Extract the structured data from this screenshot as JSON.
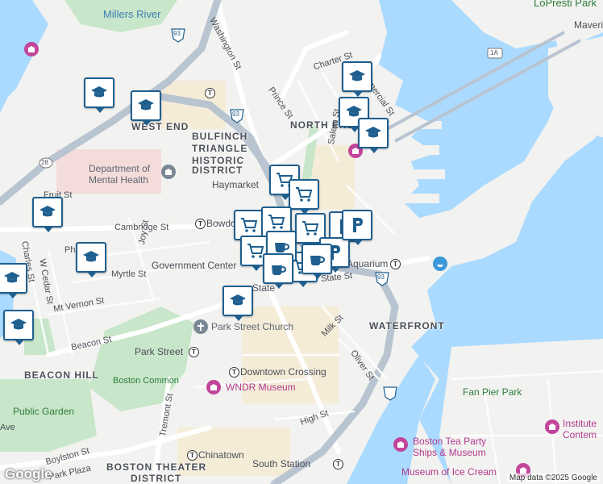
{
  "map": {
    "neighborhoods": [
      "NORTH END",
      "WEST END",
      "BULFINCH",
      "TRIANGLE",
      "HISTORIC",
      "DISTRICT",
      "WATERFRONT",
      "BEACON HILL",
      "BOSTON THEATER",
      "DISTRICT"
    ],
    "water_labels": [
      "Millers River",
      "LoPresti Park"
    ],
    "streets": [
      "Washington St",
      "Charter St",
      "Commercial St",
      "Prince St",
      "Salem St",
      "Cambridge St",
      "Joy St",
      "Charles St",
      "W Cedar St",
      "Myrtle St",
      "Mt Vernon St",
      "Beacon St",
      "Milk St",
      "State St",
      "Oliver St",
      "High St",
      "Tremont St",
      "Boylston St",
      "Park Plaza",
      "Fruit St",
      "Phillips St",
      "Maverick",
      "Ave"
    ],
    "stations": [
      "Haymarket",
      "Bowdoin",
      "Government Center",
      "State",
      "Aquarium",
      "Park Street",
      "Downtown Crossing",
      "Chinatown",
      "South Station"
    ],
    "pois": [
      "Department of",
      "Mental Health",
      "Park Street Church",
      "WNDR Museum",
      "Boston Common",
      "Public Garden",
      "Fan Pier Park",
      "Boston Tea Party",
      "Ships & Museum",
      "Museum of Ice Cream",
      "Institute",
      "Contem"
    ],
    "route_shields": [
      "93",
      "93",
      "93",
      "28",
      "1A"
    ],
    "attribution": "Map data ©2025 Google",
    "logo": "Google",
    "colors": {
      "water": "#aadaff",
      "land": "#f2f2f0",
      "park": "#c8e6c9",
      "road_major": "#ffffff",
      "highway": "#b9c4d1",
      "pin_border": "#1f5f8f",
      "poi_museum": "#c2459b"
    }
  },
  "markers": {
    "icons": [
      "school-icon",
      "shopping-cart-icon",
      "coffee-icon",
      "parking-icon"
    ]
  }
}
